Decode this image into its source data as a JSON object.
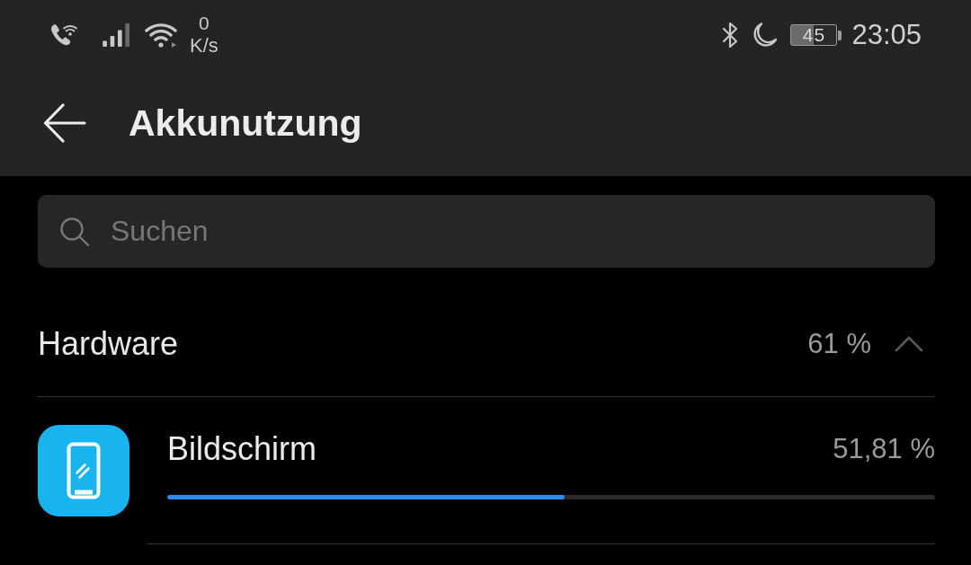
{
  "status_bar": {
    "speed_value": "0",
    "speed_unit": "K/s",
    "battery_text": "45",
    "time": "23:05"
  },
  "app_bar": {
    "title": "Akkunutzung"
  },
  "search": {
    "placeholder": "Suchen"
  },
  "sections": [
    {
      "title": "Hardware",
      "share": "61 %",
      "expanded": true,
      "items": [
        {
          "name": "Bildschirm",
          "share": "51,81 %",
          "level": 0.5181
        }
      ]
    }
  ]
}
